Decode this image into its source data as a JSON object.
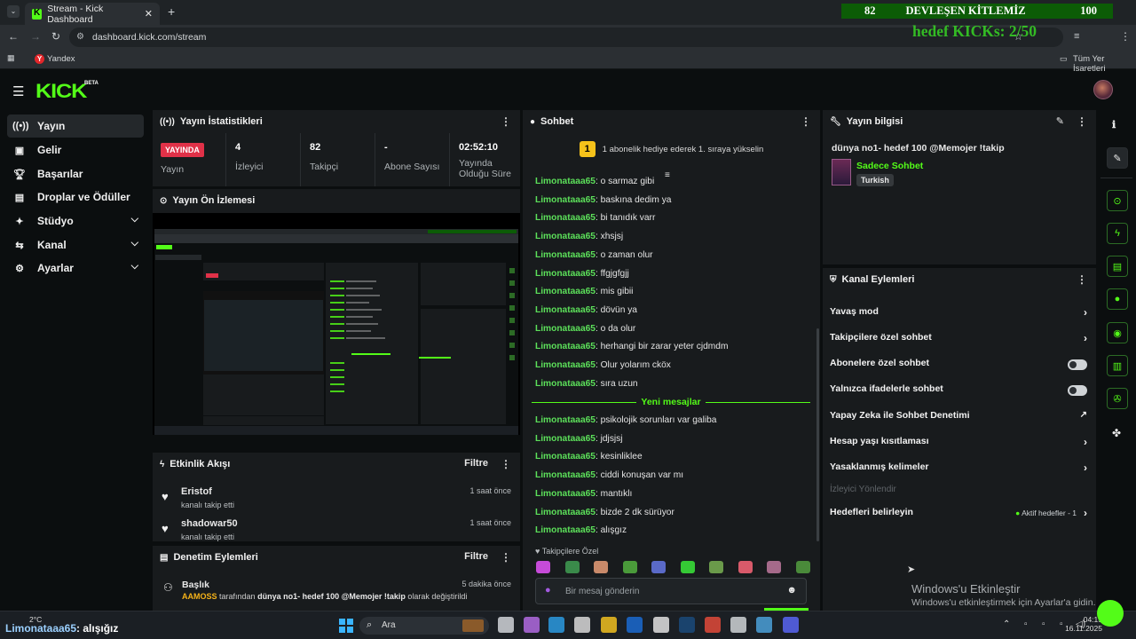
{
  "browser": {
    "tab_title": "Stream - Kick Dashboard",
    "url": "dashboard.kick.com/stream",
    "bookmark": "Yandex",
    "bookmarks_all": "Tüm Yer İşaretleri"
  },
  "overlay": {
    "left_number": "82",
    "title": "DEVLEŞEN KİTLEMİZ",
    "right_number": "100",
    "subtitle": "hedef KICKs: 2/50"
  },
  "app": {
    "logo": "KICK",
    "beta": "BETA"
  },
  "sidebar": {
    "items": [
      {
        "label": "Yayın",
        "icon": "broadcast-icon"
      },
      {
        "label": "Gelir",
        "icon": "revenue-icon"
      },
      {
        "label": "Başarılar",
        "icon": "trophy-icon"
      },
      {
        "label": "Droplar ve Ödüller",
        "icon": "gift-icon"
      },
      {
        "label": "Stüdyo",
        "icon": "studio-icon"
      },
      {
        "label": "Kanal",
        "icon": "channel-icon"
      },
      {
        "label": "Ayarlar",
        "icon": "gear-icon"
      }
    ]
  },
  "stats": {
    "title": "Yayın İstatistikleri",
    "live_badge": "YAYINDA",
    "live_label": "Yayın",
    "viewers_value": "4",
    "viewers_label": "İzleyici",
    "followers_value": "82",
    "followers_label": "Takipçi",
    "subs_value": "-",
    "subs_label": "Abone Sayısı",
    "uptime_value": "02:52:10",
    "uptime_label_1": "Yayında",
    "uptime_label_2": "Olduğu Süre"
  },
  "preview": {
    "title": "Yayın Ön İzlemesi"
  },
  "events": {
    "title": "Etkinlik Akışı",
    "filter": "Filtre",
    "rows": [
      {
        "name": "Eristof",
        "sub": "kanalı takip etti",
        "time": "1 saat önce"
      },
      {
        "name": "shadowar50",
        "sub": "kanalı takip etti",
        "time": "1 saat önce"
      }
    ]
  },
  "moderation": {
    "title": "Denetim Eylemleri",
    "filter": "Filtre",
    "row_title": "Başlık",
    "row_time": "5 dakika önce",
    "row_user": "AAMOSS",
    "row_text_1": "tarafından",
    "row_value": "dünya no1- hedef 100 @Memojer !takip",
    "row_text_2": "olarak değiştirildi"
  },
  "chat": {
    "title": "Sohbet",
    "pin_badge": "1",
    "pin_text": "1 abonelik hediye ederek 1. sıraya yükselin",
    "messages_before": [
      {
        "user": "Limonataaa65",
        "text": "o sarmaz gibi"
      },
      {
        "user": "Limonataaa65",
        "text": "baskına dedim ya"
      },
      {
        "user": "Limonataaa65",
        "text": "bi tanıdık varr"
      },
      {
        "user": "Limonataaa65",
        "text": "xhsjsj"
      },
      {
        "user": "Limonataaa65",
        "text": "o zaman olur"
      },
      {
        "user": "Limonataaa65",
        "text": "ffgjgfgjj"
      },
      {
        "user": "Limonataaa65",
        "text": "mis gibii"
      },
      {
        "user": "Limonataaa65",
        "text": "dövün ya"
      },
      {
        "user": "Limonataaa65",
        "text": "o da olur"
      },
      {
        "user": "Limonataaa65",
        "text": "herhangi bir zarar yeter cjdmdm"
      },
      {
        "user": "Limonataaa65",
        "text": "Olur yolarım cköx"
      },
      {
        "user": "Limonataaa65",
        "text": "sıra uzun"
      }
    ],
    "new_messages": "Yeni mesajlar",
    "messages_after": [
      {
        "user": "Limonataaa65",
        "text": "psikolojik sorunları var galiba"
      },
      {
        "user": "Limonataaa65",
        "text": "jdjsjsj"
      },
      {
        "user": "Limonataaa65",
        "text": "kesinliklee"
      },
      {
        "user": "Limonataaa65",
        "text": "ciddi konuşan var mı"
      },
      {
        "user": "Limonataaa65",
        "text": "mantıklı"
      },
      {
        "user": "Limonataaa65",
        "text": "bizde 2 dk sürüyor"
      },
      {
        "user": "Limonataaa65",
        "text": "alışgız"
      }
    ],
    "emotes_label": "Takipçilere Özel",
    "input_placeholder": "Bir mesaj gönderin"
  },
  "info": {
    "title": "Yayın bilgisi",
    "stream_title": "dünya no1- hedef 100 @Memojer !takip",
    "category": "Sadece Sohbet",
    "language": "Turkish"
  },
  "actions": {
    "title": "Kanal Eylemleri",
    "rows": [
      {
        "label": "Yavaş mod",
        "control": "chevron"
      },
      {
        "label": "Takipçilere özel sohbet",
        "control": "chevron"
      },
      {
        "label": "Abonelere özel sohbet",
        "control": "toggle"
      },
      {
        "label": "Yalnızca ifadelerle sohbet",
        "control": "toggle"
      },
      {
        "label": "Yapay Zeka ile Sohbet Denetimi",
        "control": "external"
      },
      {
        "label": "Hesap yaşı kısıtlaması",
        "control": "chevron"
      },
      {
        "label": "Yasaklanmış kelimeler",
        "control": "chevron"
      }
    ],
    "viewer_redirect": "İzleyici Yönlendir",
    "goals_label": "Hedefleri belirleyin",
    "goals_status": "Aktif hedefler - 1"
  },
  "windows": {
    "activate_title": "Windows'u Etkinleştir",
    "activate_sub": "Windows'u etkinleştirmek için Ayarlar'a gidin."
  },
  "taskbar": {
    "weather": "2°C",
    "ticker_user": "Limonataaa65",
    "ticker_text": ": alışığız",
    "search": "Ara",
    "time": "04:15",
    "date": "16.11.2025"
  }
}
